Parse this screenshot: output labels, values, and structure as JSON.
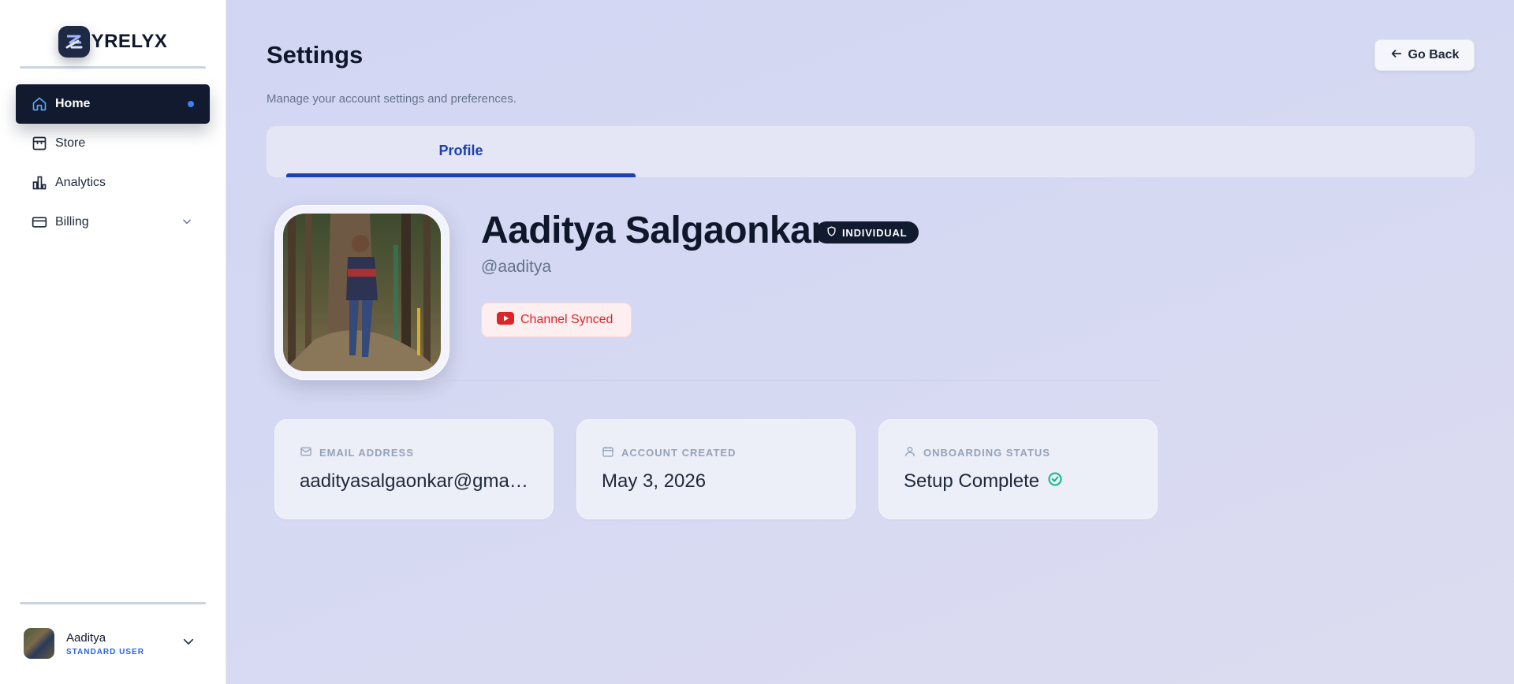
{
  "brand": {
    "name": "YRELYX"
  },
  "sidebar": {
    "items": [
      {
        "label": "Home",
        "icon": "home-icon",
        "active": true
      },
      {
        "label": "Store",
        "icon": "store-icon"
      },
      {
        "label": "Analytics",
        "icon": "analytics-icon"
      },
      {
        "label": "Billing",
        "icon": "billing-icon",
        "expandable": true
      }
    ],
    "user": {
      "name": "Aaditya",
      "role": "STANDARD USER"
    }
  },
  "header": {
    "title": "Settings",
    "subtitle": "Manage your account settings and preferences.",
    "go_back_label": "Go Back"
  },
  "tabs": [
    {
      "label": "Profile",
      "active": true
    }
  ],
  "profile": {
    "name": "Aaditya Salgaonkar",
    "account_type": "INDIVIDUAL",
    "handle": "@aaditya",
    "channel_status": "Channel Synced"
  },
  "cards": [
    {
      "label": "EMAIL ADDRESS",
      "value": "aadityasalgaonkar@gma…",
      "icon": "mail-icon"
    },
    {
      "label": "ACCOUNT CREATED",
      "value": "May 3, 2026",
      "icon": "calendar-icon"
    },
    {
      "label": "ONBOARDING STATUS",
      "value": "Setup Complete",
      "icon": "user-icon",
      "status_icon": "check-circle-icon"
    }
  ],
  "colors": {
    "accent": "#1e40af",
    "sidebar_active": "#111a2e",
    "youtube_red": "#dc2626",
    "success": "#10b981"
  }
}
